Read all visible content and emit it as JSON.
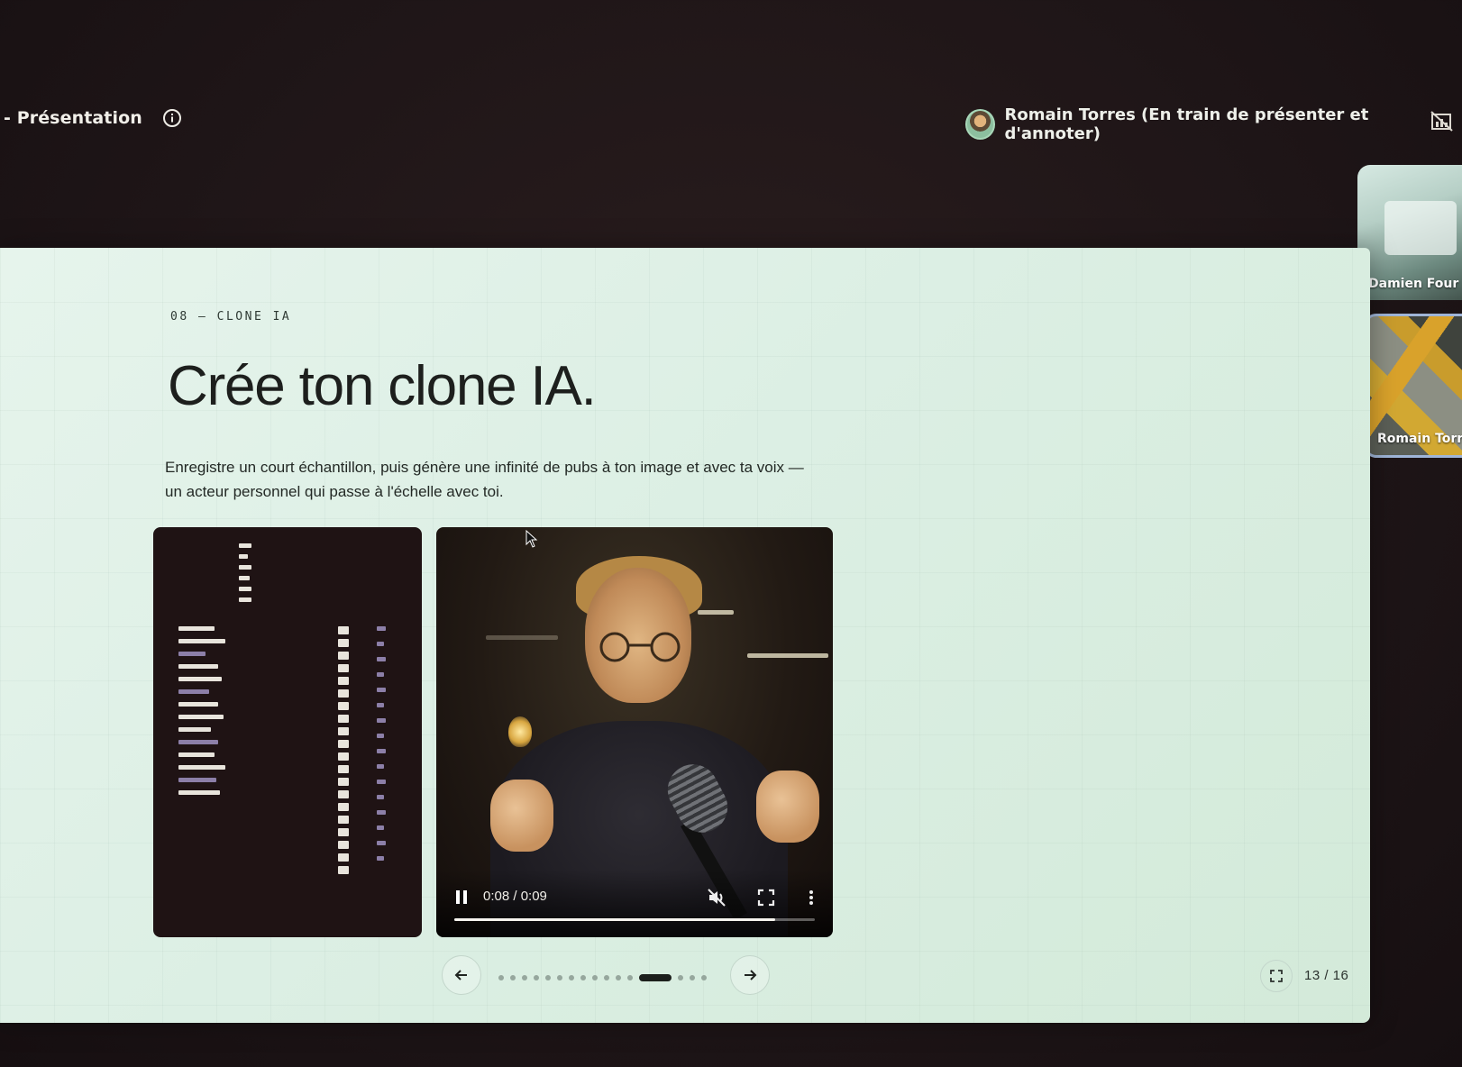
{
  "meeting": {
    "title": "- Présentation",
    "presenter_label": "Romain Torres (En train de présenter et d'annoter)"
  },
  "participants": [
    {
      "name": "Damien Four"
    },
    {
      "name": "Romain Torr"
    }
  ],
  "slide": {
    "eyebrow": "08 — CLONE IA",
    "title": "Crée ton clone IA.",
    "body": "Enregistre un court échantillon, puis génère une infinité de pubs à ton image et avec ta voix — un acteur personnel qui passe à l'échelle avec toi.",
    "video": {
      "time": "0:08 / 0:09",
      "progress": 0.89,
      "state": "playing",
      "muted": true
    },
    "pagination": {
      "dot_count": 16,
      "active_index": 12
    },
    "counter": "13 / 16"
  },
  "icons": {
    "info": "info-icon",
    "presentation_off": "presentation-off-icon",
    "prev": "arrow-left-icon",
    "next": "arrow-right-icon",
    "fullscreen": "fullscreen-icon",
    "pause": "pause-icon",
    "mute": "volume-off-icon",
    "more": "more-vert-icon"
  }
}
